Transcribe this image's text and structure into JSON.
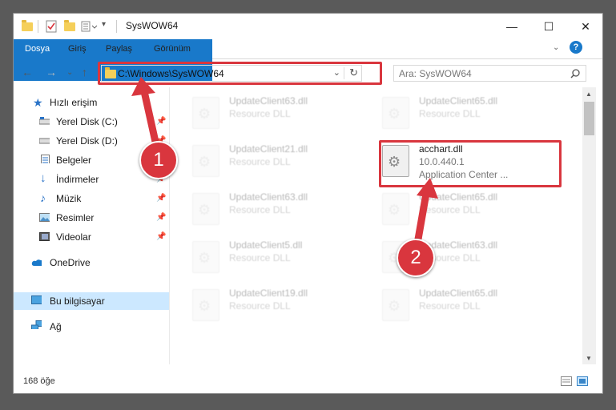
{
  "window": {
    "title": "SysWOW64",
    "controls": {
      "minimize": "—",
      "maximize": "☐",
      "close": "✕"
    }
  },
  "ribbon": {
    "tabs": [
      "Dosya",
      "Giriş",
      "Paylaş",
      "Görünüm"
    ],
    "help": "?"
  },
  "address": {
    "path": "C:\\Windows\\SysWOW64",
    "refresh_icon": "↻"
  },
  "search": {
    "placeholder": "Ara: SysWOW64"
  },
  "nav": {
    "items": [
      {
        "label": "Hızlı erişim",
        "icon": "star-icon",
        "color": "#2a73c7"
      },
      {
        "label": "Yerel Disk (C:)",
        "icon": "drive-icon",
        "pinned": true
      },
      {
        "label": "Yerel Disk (D:)",
        "icon": "drive-icon",
        "pinned": true
      },
      {
        "label": "Belgeler",
        "icon": "documents-icon",
        "pinned": true
      },
      {
        "label": "İndirmeler",
        "icon": "downloads-icon",
        "pinned": true
      },
      {
        "label": "Müzik",
        "icon": "music-icon",
        "pinned": true
      },
      {
        "label": "Resimler",
        "icon": "pictures-icon",
        "pinned": true
      },
      {
        "label": "Videolar",
        "icon": "videos-icon",
        "pinned": true
      },
      {
        "label": "OneDrive",
        "icon": "cloud-icon"
      },
      {
        "label": "Bu bilgisayar",
        "icon": "computer-icon",
        "selected": true
      },
      {
        "label": "Ağ",
        "icon": "network-icon"
      }
    ]
  },
  "files": [
    {
      "name": "UpdateClient63.dll",
      "type": "Resource DLL",
      "ghost": true
    },
    {
      "name": "UpdateClient65.dll",
      "type": "Resource DLL",
      "ghost": true
    },
    {
      "name": "UpdateClient21.dll",
      "type": "Resource DLL",
      "ghost": true
    },
    {
      "name": "acchart.dll",
      "type": "10.0.440.1",
      "desc": "Application Center ...",
      "ghost": false
    },
    {
      "name": "UpdateClient63.dll",
      "type": "Resource DLL",
      "ghost": true
    },
    {
      "name": "UpdateClient65.dll",
      "type": "Resource DLL",
      "ghost": true
    },
    {
      "name": "UpdateClient5.dll",
      "type": "Resource DLL",
      "ghost": true
    },
    {
      "name": "UpdateClient63.dll",
      "type": "Resource DLL",
      "ghost": true
    },
    {
      "name": "UpdateClient19.dll",
      "type": "Resource DLL",
      "ghost": true
    },
    {
      "name": "UpdateClient65.dll",
      "type": "Resource DLL",
      "ghost": true
    }
  ],
  "status": {
    "count": "168 öğe"
  },
  "annotations": {
    "step1": "1",
    "step2": "2",
    "color": "#d9363e"
  }
}
